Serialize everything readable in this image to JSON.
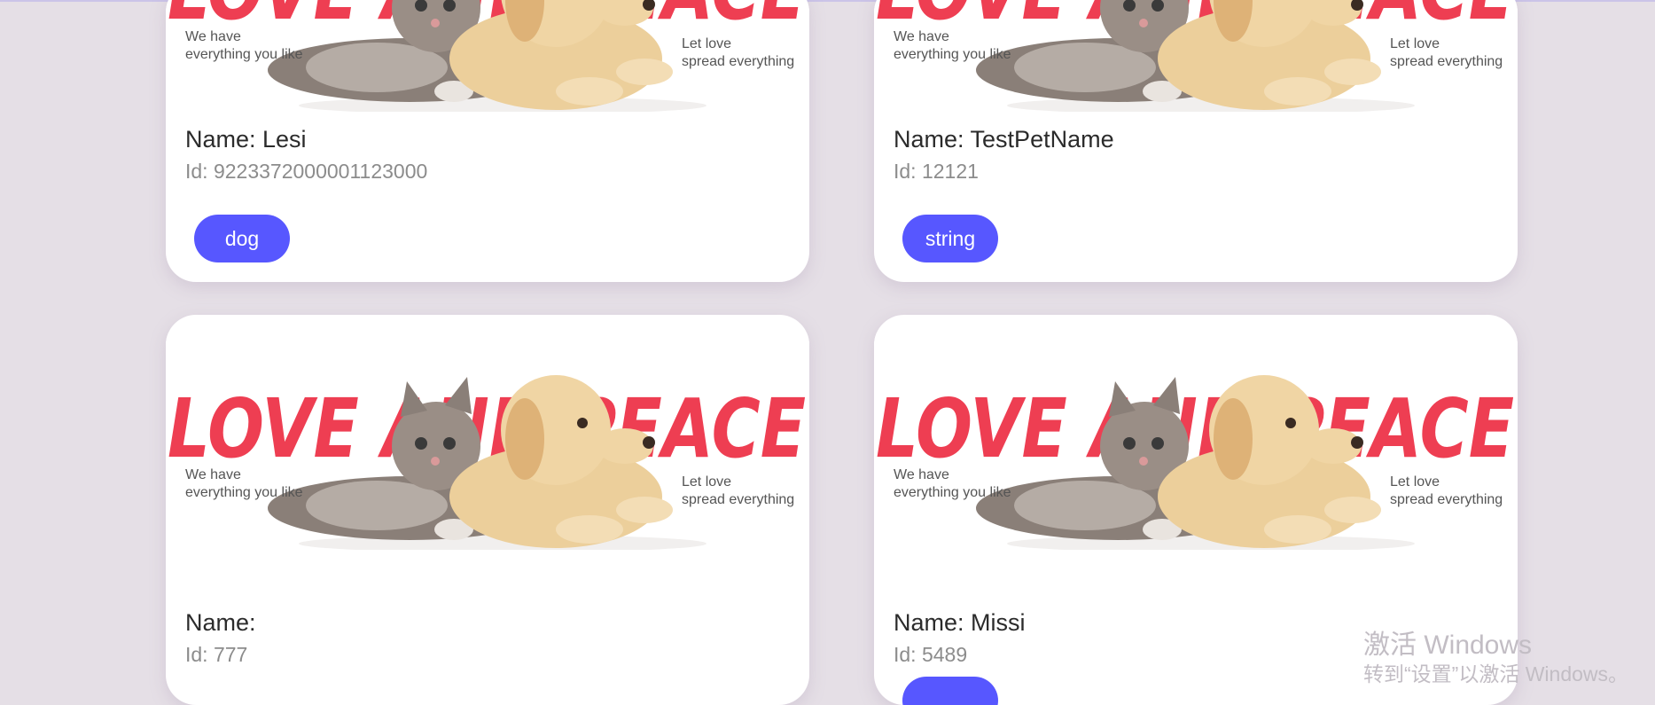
{
  "banner": {
    "headline": "LOVE AND PEACE",
    "left_line1": "We have",
    "left_line2": "everything you like",
    "right_line1": "Let love",
    "right_line2": "spread everything"
  },
  "colors": {
    "page_background": "#e5dfe6",
    "tag_background": "#5757ff",
    "headline_red": "#ee3e52"
  },
  "pets": [
    {
      "name_text": "Name: Lesi",
      "id_text": "Id: 9223372000001123000",
      "tag": "dog"
    },
    {
      "name_text": "Name: TestPetName",
      "id_text": "Id: 12121",
      "tag": "string"
    },
    {
      "name_text": "Name:",
      "id_text": "Id: 777",
      "tag": ""
    },
    {
      "name_text": "Name: Missi",
      "id_text": "Id: 5489",
      "tag": ""
    }
  ],
  "watermark": {
    "title": "激活 Windows",
    "subtitle": "转到“设置”以激活 Windows。"
  }
}
